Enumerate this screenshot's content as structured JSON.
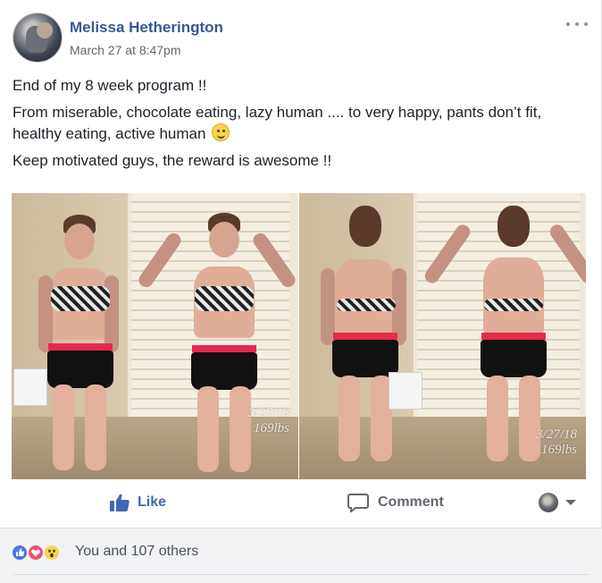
{
  "post": {
    "author": "Melissa Hetherington",
    "timestamp": "March 27 at 8:47pm",
    "paragraphs": [
      "End of my 8 week program !!",
      "From miserable, chocolate eating, lazy human .... to very happy, pants don’t fit, healthy eating, active human",
      "Keep motivated guys, the reward is awesome !!"
    ],
    "photos": [
      {
        "caption_date": "3/27/18",
        "caption_weight": "169lbs",
        "sign_text": ""
      },
      {
        "caption_date": "3/27/18",
        "caption_weight": "169lbs",
        "sign_text": ""
      }
    ]
  },
  "actions": {
    "like_label": "Like",
    "comment_label": "Comment"
  },
  "reactions": {
    "summary": "You and 107 others",
    "types": [
      "like-icon",
      "love-icon",
      "wow-icon"
    ]
  },
  "colors": {
    "link_blue": "#365899",
    "like_blue": "#4267b2",
    "muted_gray": "#616770",
    "reactions_bg": "#f2f3f5"
  }
}
